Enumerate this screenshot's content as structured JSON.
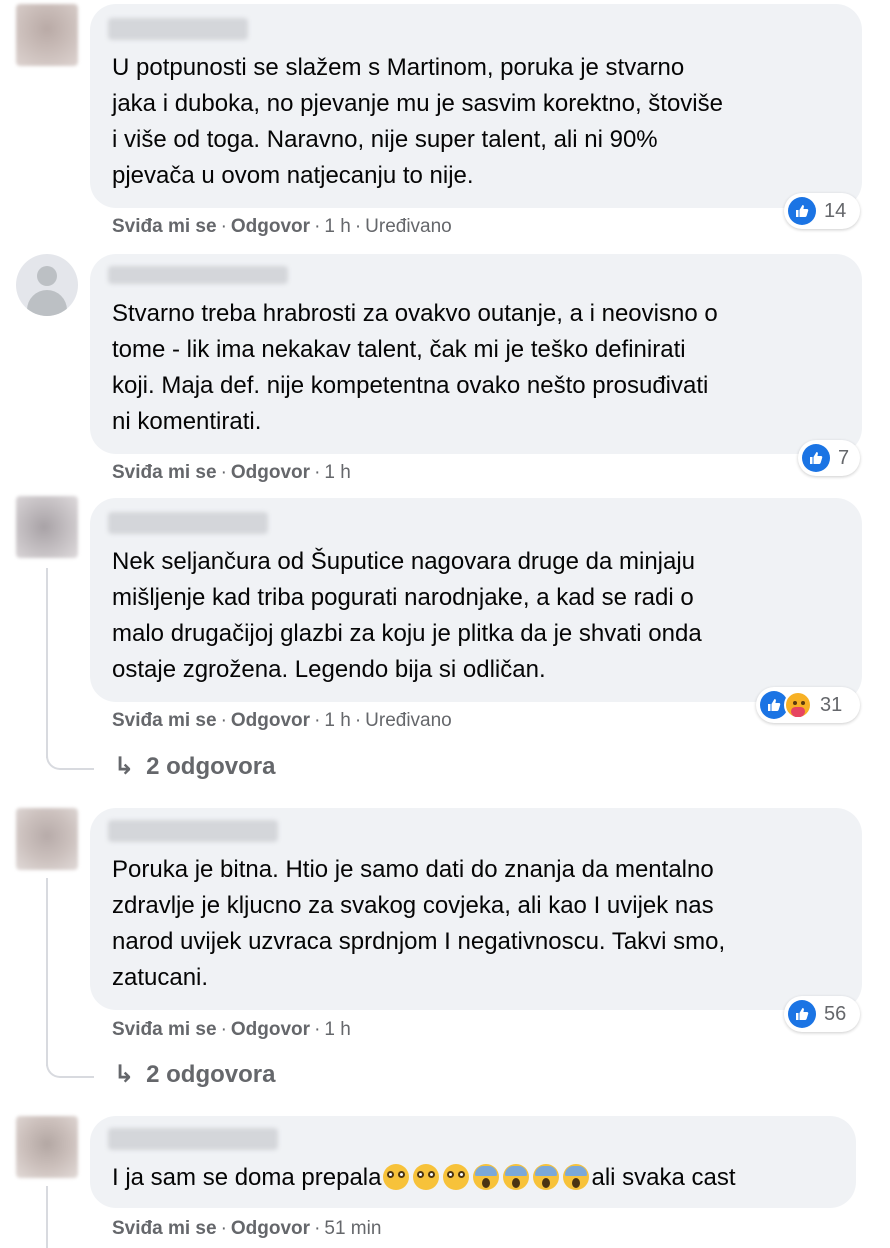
{
  "actions": {
    "like": "Sviđa mi se",
    "reply": "Odgovor",
    "separator": "·",
    "edited": "Uređivano"
  },
  "colors": {
    "like_blue": "#1b74e4",
    "bubble_bg": "#f0f2f5",
    "meta_gray": "#65676b"
  },
  "comments": [
    {
      "text": "U potpunosti se slažem s Martinom, poruka je stvarno\njaka i duboka, no pjevanje mu je sasvim korektno, štoviše\ni više od toga. Naravno, nije super talent, ali ni 90%\npjevača u ovom natjecanju to nije.",
      "reaction_count": "14",
      "reaction_icons": [
        "like-icon"
      ],
      "time": "1 h",
      "edited": true
    },
    {
      "text": "Stvarno treba hrabrosti za ovakvo outanje, a i neovisno o\ntome - lik ima nekakav talent, čak mi je teško definirati\nkoji. Maja def. nije kompetentna ovako nešto prosuđivati\nni komentirati.",
      "reaction_count": "7",
      "reaction_icons": [
        "like-icon"
      ],
      "time": "1 h",
      "edited": false
    },
    {
      "text": "Nek seljančura od Šuputice nagovara druge da minjaju\nmišljenje kad triba pogurati narodnjake, a kad se radi o\nmalo drugačijoj glazbi za koju je plitka da je shvati onda\nostaje zgrožena. Legendo bija si odličan.",
      "reaction_count": "31",
      "reaction_icons": [
        "like-icon",
        "care-icon"
      ],
      "time": "1 h",
      "edited": true,
      "replies": "2 odgovora"
    },
    {
      "text": "Poruka je bitna. Htio je samo dati do znanja da mentalno\nzdravlje je kljucno za svakog covjeka, ali kao I uvijek nas\nnarod uvijek uzvraca sprdnjom I negativnoscu. Takvi smo,\nzatucani.",
      "reaction_count": "56",
      "reaction_icons": [
        "like-icon"
      ],
      "time": "1 h",
      "edited": false,
      "replies": "2 odgovora"
    },
    {
      "text_before": "I ja sam se doma prepala",
      "text_after": "ali svaka cast",
      "emojis": [
        "flushed-face-emoji",
        "flushed-face-emoji",
        "flushed-face-emoji",
        "scream-emoji",
        "scream-emoji",
        "scream-emoji",
        "scream-emoji"
      ],
      "time": "51 min",
      "edited": false
    }
  ]
}
